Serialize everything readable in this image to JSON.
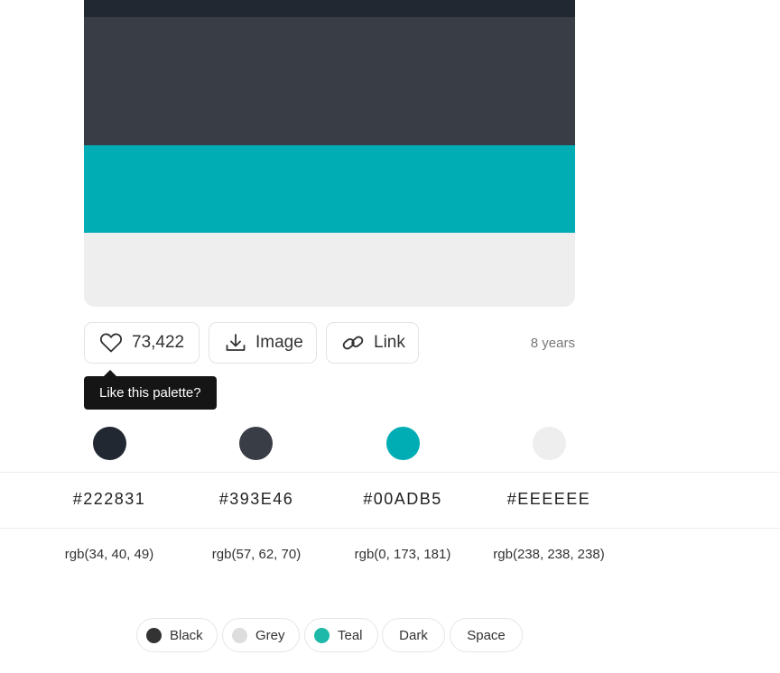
{
  "palette": {
    "colors": [
      {
        "hex": "#222831",
        "rgb": "rgb(34, 40, 49)",
        "swatch": "#222831"
      },
      {
        "hex": "#393E46",
        "rgb": "rgb(57, 62, 70)",
        "swatch": "#393E46"
      },
      {
        "hex": "#00ADB5",
        "rgb": "rgb(0, 173, 181)",
        "swatch": "#00ADB5"
      },
      {
        "hex": "#EEEEEE",
        "rgb": "rgb(238, 238, 238)",
        "swatch": "#EEEEEE"
      }
    ]
  },
  "actions": {
    "likes": "73,422",
    "image_label": "Image",
    "link_label": "Link",
    "age": "8 years"
  },
  "tooltip": {
    "text": "Like this palette?"
  },
  "tags": [
    {
      "label": "Black",
      "dot": "#333333"
    },
    {
      "label": "Grey",
      "dot": "#dddddd"
    },
    {
      "label": "Teal",
      "dot": "#1eb9a8"
    },
    {
      "label": "Dark"
    },
    {
      "label": "Space"
    }
  ]
}
